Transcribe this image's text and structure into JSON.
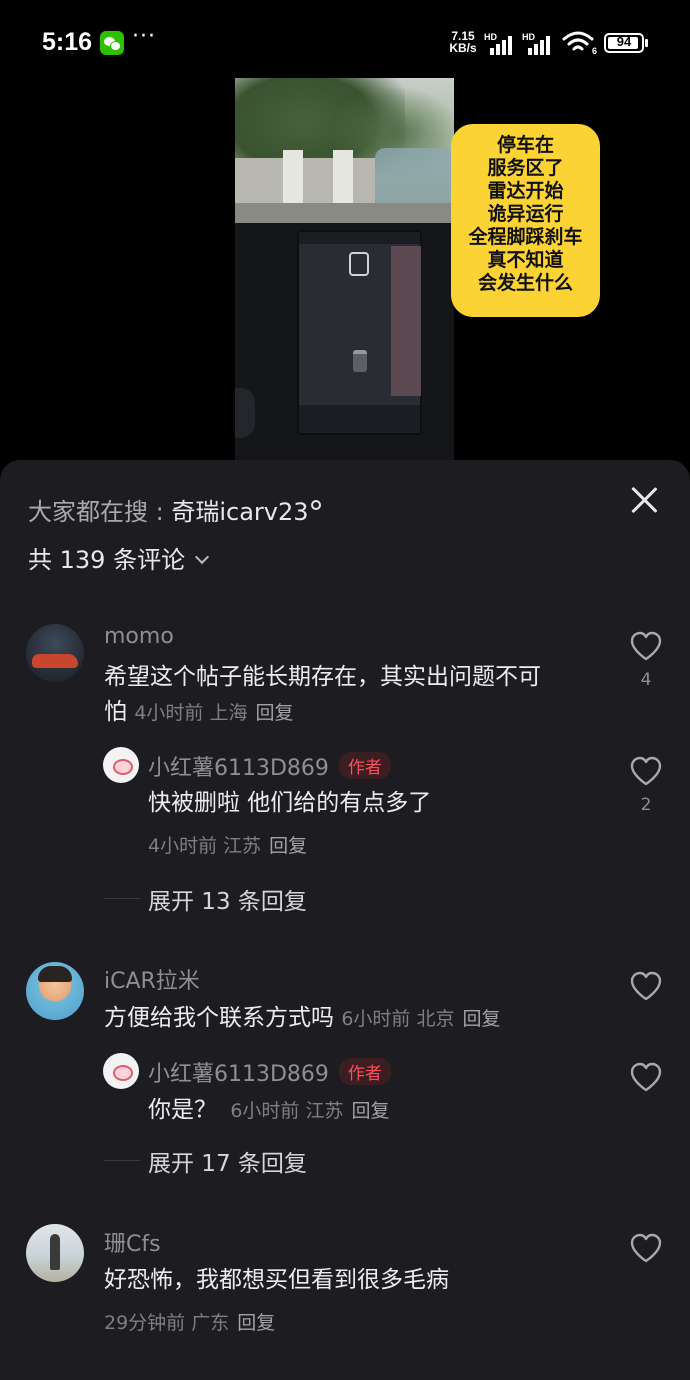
{
  "status_bar": {
    "time": "5:16",
    "more": "···",
    "net_speed_value": "7.15",
    "net_speed_unit": "KB/s",
    "sim1_label": "HD",
    "sim2_label": "HD",
    "wifi_badge": "6",
    "battery": "94",
    "battery_level": 0.94
  },
  "video": {
    "caption_lines": [
      "停车在",
      "服务区了",
      "雷达开始",
      "诡异运行",
      "全程脚踩刹车",
      "真不知道",
      "会发生什么"
    ]
  },
  "comments_panel": {
    "search_prefix": "大家都在搜 : ",
    "search_term": "奇瑞icarv23",
    "count_label": "共 139 条评论",
    "threads": [
      {
        "user": "momo",
        "text_line1": "希望这个帖子能长期存在，其实出问题不可",
        "text_line2": "怕",
        "meta": "4小时前 上海",
        "reply_label": "回复",
        "likes": "4",
        "reply": {
          "user": "小红薯6113D869",
          "badge": "作者",
          "text": "快被删啦 他们给的有点多了",
          "meta": "4小时前 江苏",
          "reply_label": "回复",
          "likes": "2"
        },
        "expand": "展开 13 条回复"
      },
      {
        "user": "iCAR拉米",
        "text": "方便给我个联系方式吗",
        "meta": "6小时前 北京",
        "reply_label": "回复",
        "reply": {
          "user": "小红薯6113D869",
          "badge": "作者",
          "text": "你是？",
          "meta": "6小时前 江苏",
          "reply_label": "回复"
        },
        "expand": "展开 17 条回复"
      },
      {
        "user": "珊Cfs",
        "text": "好恐怖，我都想买但看到很多毛病",
        "meta": "29分钟前 广东",
        "reply_label": "回复"
      }
    ]
  },
  "icons": {
    "close": "close-icon",
    "like": "heart-outline-icon",
    "search": "search-icon",
    "chevron": "chevron-down-icon"
  },
  "colors": {
    "sheet_bg": "#1d1d21",
    "caption_bg": "#fbd334",
    "author_badge": "#ff4d5e"
  }
}
